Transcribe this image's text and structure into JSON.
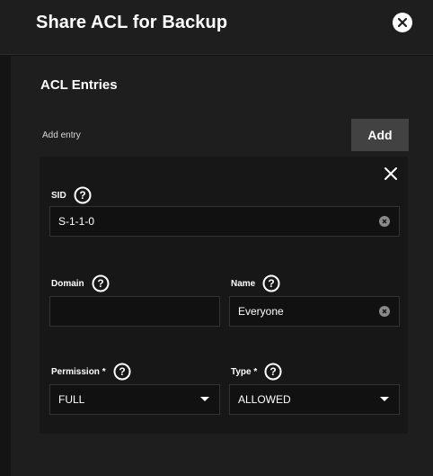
{
  "dialog": {
    "title": "Share ACL for Backup",
    "close_icon": "close-circle-icon"
  },
  "acl": {
    "section_title": "ACL Entries",
    "add_entry_label": "Add entry",
    "add_button_label": "Add",
    "entry": {
      "remove_icon": "close-icon",
      "sid": {
        "label": "SID",
        "value": "S-1-1-0",
        "help_icon": "help-icon",
        "clear_icon": "clear-icon"
      },
      "domain": {
        "label": "Domain",
        "value": "",
        "help_icon": "help-icon"
      },
      "name": {
        "label": "Name",
        "value": "Everyone",
        "help_icon": "help-icon",
        "clear_icon": "clear-icon"
      },
      "permission": {
        "label": "Permission *",
        "value": "FULL",
        "help_icon": "help-icon"
      },
      "type": {
        "label": "Type *",
        "value": "ALLOWED",
        "help_icon": "help-icon"
      }
    }
  },
  "colors": {
    "background": "#1e1e1e",
    "card": "#171717",
    "input": "#111111",
    "button": "#424242",
    "text": "#ffffff"
  }
}
